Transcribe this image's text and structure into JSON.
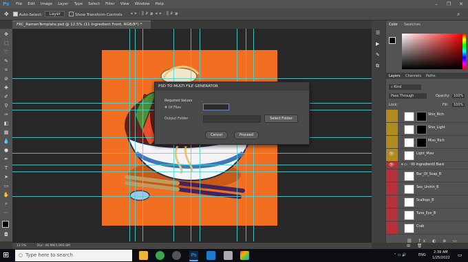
{
  "menubar": {
    "app_logo": "Ps",
    "items": [
      "File",
      "Edit",
      "Image",
      "Layer",
      "Type",
      "Select",
      "Filter",
      "View",
      "Window",
      "Help"
    ],
    "window_controls": [
      "minimize-icon",
      "restore-icon",
      "close-icon"
    ]
  },
  "options_bar": {
    "auto_select_label": "Auto-Select:",
    "auto_select_value": "Layer",
    "transform_label": "Show Transform Controls"
  },
  "document": {
    "tab_title": "FRC_RamenTemplate.psd @ 12.5% (11 Ingredient Front, RGB/8*) *",
    "zoom": "12.5%",
    "doc_size": "Doc: 46.9M/1,993.8M",
    "accent_color": "#f26f21",
    "guide_color": "#4fd6d6"
  },
  "dialog": {
    "title": "PSD TO MULTI FILE GENERATOR",
    "section_label": "Required Values",
    "files_label": "# Of Files",
    "files_value": "",
    "output_label": "Output Folder",
    "output_value": "",
    "select_folder_button": "Select Folder",
    "cancel_button": "Cancel",
    "proceed_button": "Proceed"
  },
  "color_panel": {
    "tabs": [
      "Color",
      "Swatches"
    ]
  },
  "layers_panel": {
    "tabs": [
      "Layers",
      "Channels",
      "Paths"
    ],
    "filter_label": "Kind",
    "blend_mode": "Pass Through",
    "opacity_label": "Opacity:",
    "opacity_value": "100%",
    "lock_label": "Lock:",
    "fill_label": "Fill:",
    "fill_value": "100%",
    "layers": [
      {
        "name": "Shio_Rich"
      },
      {
        "name": "Shio_Light"
      },
      {
        "name": "Miso_Rich"
      },
      {
        "name": "Light_Miso"
      },
      {
        "name": "00 Ingredient0 Back"
      },
      {
        "name": "Bar_Of_Soap_B"
      },
      {
        "name": "Sea_Urchin_B"
      },
      {
        "name": "Scallops_B"
      },
      {
        "name": "Tuna_Eye_B"
      },
      {
        "name": "Crab"
      }
    ]
  },
  "taskbar": {
    "search_placeholder": "Type here to search",
    "language": "ENG",
    "time": "2:39 AM",
    "date": "1/25/2022"
  }
}
